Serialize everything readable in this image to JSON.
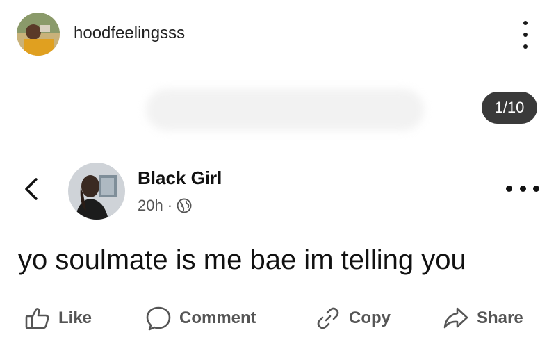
{
  "story_header": {
    "username": "hoodfeelingsss",
    "more_icon": "more-vertical-icon",
    "counter": "1/10"
  },
  "post": {
    "author": "Black Girl",
    "time": "20h",
    "separator": "·",
    "audience_icon": "globe-icon",
    "more_icon": "more-horizontal-icon",
    "back_icon": "chevron-left-icon",
    "text": "yo soulmate is me bae im telling you"
  },
  "actions": {
    "like": "Like",
    "comment": "Comment",
    "copy": "Copy",
    "share": "Share"
  },
  "colors": {
    "counter_bg": "#3a3a3a",
    "action_text": "#555555",
    "text": "#111111"
  }
}
